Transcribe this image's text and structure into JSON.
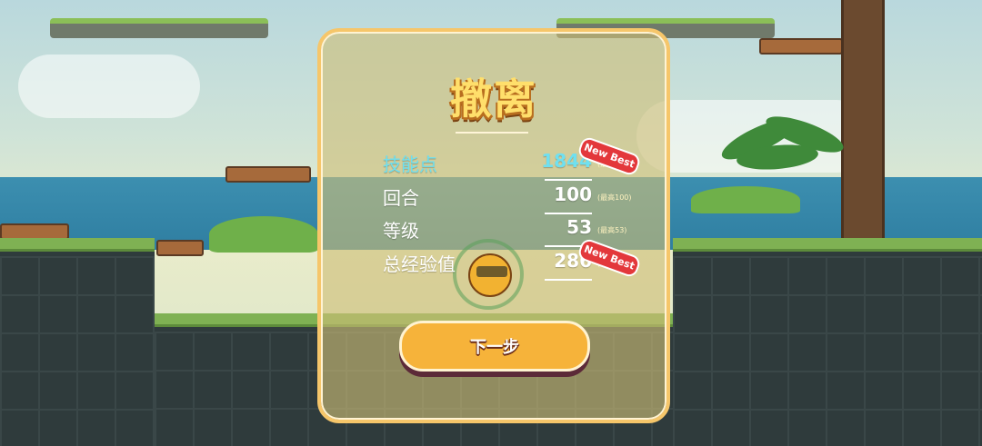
{
  "screen": {
    "title": "撤离",
    "stats": [
      {
        "label": "技能点",
        "value": "1844",
        "best": "(最高1",
        "new_best": true,
        "highlight": true
      },
      {
        "label": "回合",
        "value": "100",
        "best": "(最高100)",
        "new_best": false,
        "highlight": false
      },
      {
        "label": "等级",
        "value": "53",
        "best": "(最高53)",
        "new_best": false,
        "highlight": false
      },
      {
        "label": "总经验值",
        "value": "286",
        "best": "(最高2",
        "new_best": true,
        "highlight": false
      }
    ],
    "badge_text": "New Best",
    "next_button": "下一步"
  },
  "colors": {
    "panel_border": "#f6c66a",
    "title": "#ffdf6b",
    "highlight": "#6fe0f0",
    "badge": "#e3383b",
    "button": "#f6b33a"
  },
  "icons": [
    "palm-tree-icon",
    "character-sprite"
  ]
}
